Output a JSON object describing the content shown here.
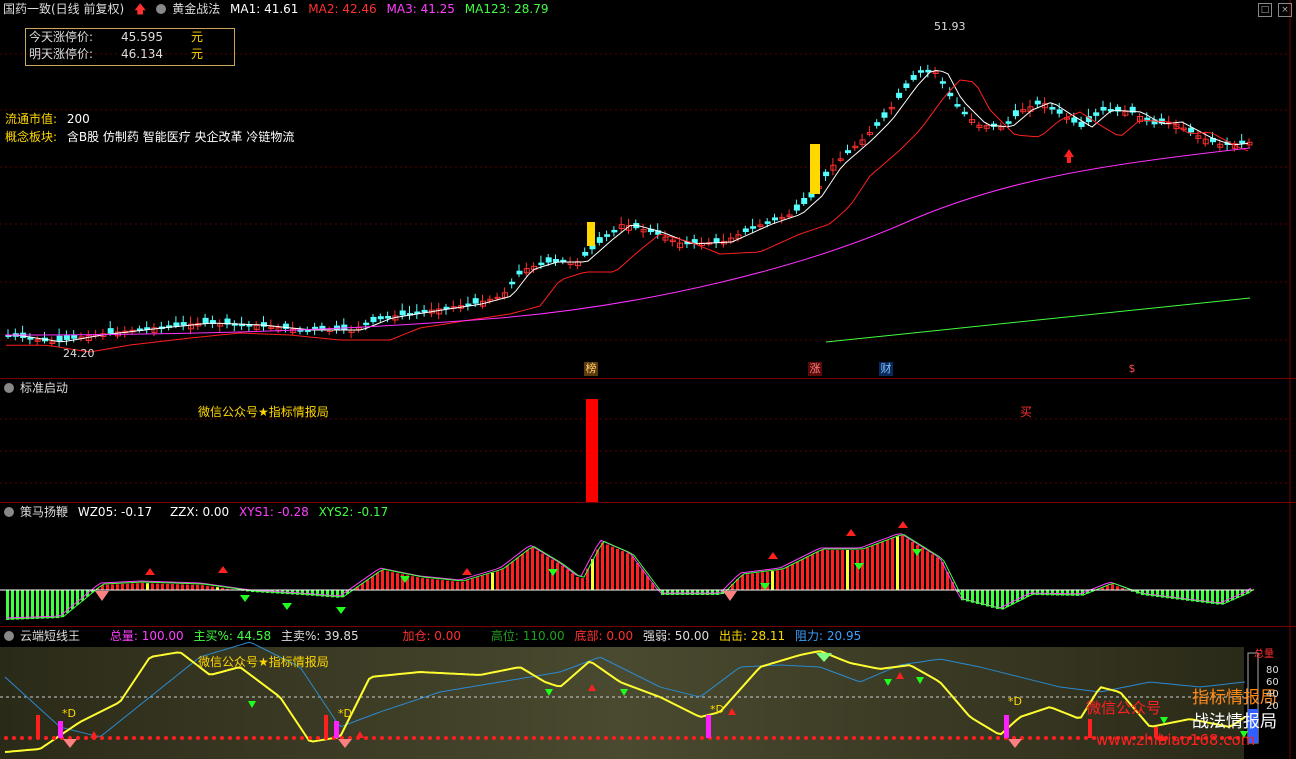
{
  "header": {
    "stock": "国药一致(日线 前复权)",
    "indicator": "黄金战法",
    "ma1": "MA1: 41.61",
    "ma2": "MA2: 42.46",
    "ma3": "MA3: 41.25",
    "ma123": "MA123: 28.79"
  },
  "info": {
    "today_label": "今天涨停价:",
    "today_value": "45.595",
    "tomorrow_label": "明天涨停价:",
    "tomorrow_value": "46.134",
    "unit": "元",
    "float_label": "流通市值:",
    "float_value": "200",
    "concept_label": "概念板块:",
    "concept_value": "含B股 仿制药 智能医疗 央企改革 冷链物流"
  },
  "price_marks": {
    "high": "51.93",
    "low": "24.20"
  },
  "event_tags": [
    "榜",
    "涨",
    "财",
    "$"
  ],
  "panel2": {
    "title": "标准启动",
    "watermark": "微信公众号★指标情报局",
    "buy": "买"
  },
  "panel3": {
    "title": "策马扬鞭",
    "wz05": "WZ05: -0.17",
    "zzx": "ZZX: 0.00",
    "xys1": "XYS1: -0.28",
    "xys2": "XYS2: -0.17"
  },
  "panel4": {
    "title": "云端短线王",
    "total": "总量: 100.00",
    "buy_pct": "主买%: 44.58",
    "sell_pct": "主卖%: 39.85",
    "add": "加仓: 0.00",
    "high": "高位: 110.00",
    "bottom": "底部: 0.00",
    "strength": "强弱: 50.00",
    "exit": "出击: 28.11",
    "resist": "阻力: 20.95",
    "watermark": "微信公众号★指标情报局",
    "overlay1": "微信公众号",
    "overlay2": "指标情报局",
    "overlay3": "战法情报局",
    "site": "www.zhibiao168.com",
    "scale_top": "总量",
    "scale": [
      "80",
      "60",
      "40",
      "20"
    ],
    "d_mark": "*D"
  },
  "colors": {
    "up": "#ff3030",
    "down": "#54ffff",
    "ma1": "#ffffff",
    "ma2": "#ff2020",
    "ma3": "#ff30ff",
    "ma123": "#40ff40",
    "accent": "#ffd800"
  }
}
